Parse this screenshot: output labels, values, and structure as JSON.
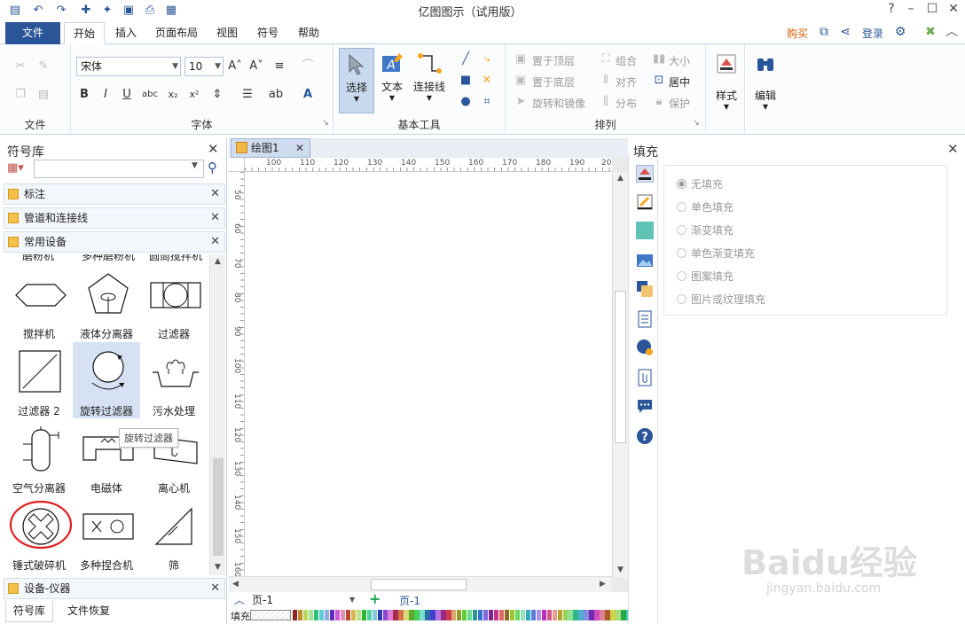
{
  "window": {
    "title": "亿图图示（试用版）"
  },
  "menu": {
    "file": "文件",
    "tabs": [
      "开始",
      "插入",
      "页面布局",
      "视图",
      "符号",
      "帮助"
    ],
    "buy": "购买",
    "login": "登录"
  },
  "ribbon": {
    "groups": {
      "file": "文件",
      "font": "字体",
      "basic_tools": "基本工具",
      "arrange": "排列"
    },
    "font_name": "宋体",
    "font_size": "10",
    "buttons": {
      "select": "选择",
      "text": "文本",
      "connector": "连接线",
      "style": "样式",
      "edit": "编辑"
    },
    "arrange": {
      "bring_front": "置于顶层",
      "send_back": "置于底层",
      "rotate_mirror": "旋转和镜像",
      "group": "组合",
      "align": "对齐",
      "distribute": "分布",
      "size": "大小",
      "center": "居中",
      "protect": "保护"
    }
  },
  "symbol_panel": {
    "title": "符号库",
    "search_placeholder": "",
    "categories": [
      "标注",
      "管道和连接线",
      "常用设备"
    ],
    "bottom_category": "设备-仪器",
    "partial_row": [
      "磨粉机",
      "多种磨粉机",
      "圆筒搅拌机"
    ],
    "shapes": [
      {
        "label": "搅拌机"
      },
      {
        "label": "液体分离器"
      },
      {
        "label": "过滤器"
      },
      {
        "label": "过滤器 2"
      },
      {
        "label": "旋转过滤器",
        "selected": true
      },
      {
        "label": "污水处理"
      },
      {
        "label": "空气分离器"
      },
      {
        "label": "电磁体"
      },
      {
        "label": "离心机"
      },
      {
        "label": "锤式破碎机",
        "circled": true
      },
      {
        "label": "多种捏合机"
      },
      {
        "label": "筛"
      }
    ],
    "tooltip": "旋转过滤器",
    "bottom_tabs": [
      "符号库",
      "文件恢复"
    ]
  },
  "document": {
    "tab": "绘图1",
    "ruler_top": [
      "100",
      "110",
      "120",
      "130",
      "140",
      "150",
      "160",
      "170",
      "180",
      "190",
      "20"
    ],
    "ruler_left": [
      "50",
      "60",
      "70",
      "80",
      "90",
      "100",
      "110",
      "120",
      "130",
      "140",
      "150",
      "160"
    ],
    "page_selector": "页-1",
    "page_tab": "页-1",
    "fill_label": "填充"
  },
  "fill_panel": {
    "title": "填充",
    "options": [
      "无填充",
      "单色填充",
      "渐变填充",
      "单色渐变填充",
      "图案填充",
      "图片或纹理填充"
    ],
    "selected_index": 0
  },
  "watermark": {
    "main": "Baidu经验",
    "sub": "jingyan.baidu.com"
  },
  "colors": {
    "accent": "#2a5699",
    "selection": "#d6e2f3",
    "highlight_circle": "#e02020",
    "buy": "#e05a00"
  }
}
